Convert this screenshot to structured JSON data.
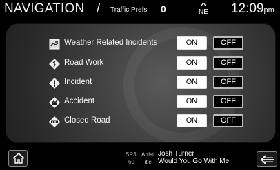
{
  "header": {
    "title": "NAVIGATION",
    "separator": "/",
    "subtitle": "Traffic Prefs",
    "count": "0",
    "compass": "NE",
    "clock": "12:09",
    "ampm": "pm"
  },
  "settings": {
    "rows": [
      {
        "label": "Weather Related Incidents",
        "icon": "weather-icon",
        "on_label": "ON",
        "off_label": "OFF",
        "selected": "ON"
      },
      {
        "label": "Road Work",
        "icon": "road-work-icon",
        "on_label": "ON",
        "off_label": "OFF",
        "selected": "ON"
      },
      {
        "label": "Incident",
        "icon": "incident-icon",
        "on_label": "ON",
        "off_label": "OFF",
        "selected": "ON"
      },
      {
        "label": "Accident",
        "icon": "accident-icon",
        "on_label": "ON",
        "off_label": "OFF",
        "selected": "ON"
      },
      {
        "label": "Closed Road",
        "icon": "closed-road-icon",
        "on_label": "ON",
        "off_label": "OFF",
        "selected": "ON"
      }
    ]
  },
  "now_playing": {
    "band": "SR3",
    "channel": "60",
    "artist_label": "Artist",
    "artist": "Josh Turner",
    "title_label": "Title",
    "title": "Would You Go With Me"
  },
  "footer": {
    "home_icon": "home-icon",
    "back_icon": "back-arrow-icon"
  },
  "colors": {
    "on_button": "#ffffff",
    "off_button": "#000000",
    "panel": "#3d3d3d"
  }
}
